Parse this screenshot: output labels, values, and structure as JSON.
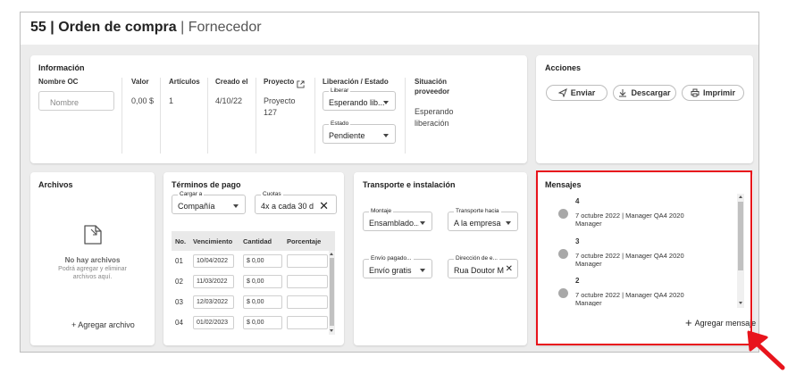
{
  "header": {
    "order_number": "55",
    "separator": "|",
    "order_label": "Orden de compra",
    "supplier": "| Fornecedor"
  },
  "info": {
    "title": "Información",
    "nombre_oc_label": "Nombre OC",
    "nombre_oc_placeholder": "Nombre",
    "valor_label": "Valor",
    "valor_value": "0,00 $",
    "articulos_label": "Artículos",
    "articulos_value": "1",
    "creado_label": "Creado el",
    "creado_value": "4/10/22",
    "proyecto_label": "Proyecto",
    "proyecto_value_1": "Proyecto",
    "proyecto_value_2": "127",
    "liberacion_label": "Liberación / Estado",
    "liberar_label": "Liberar",
    "liberar_value": "Esperando lib...",
    "estado_label": "Estado",
    "estado_value": "Pendiente",
    "situacion_label_1": "Situación",
    "situacion_label_2": "proveedor",
    "situacion_value_1": "Esperando",
    "situacion_value_2": "liberación"
  },
  "acciones": {
    "title": "Acciones",
    "enviar": "Enviar",
    "descargar": "Descargar",
    "imprimir": "Imprimir"
  },
  "archivos": {
    "title": "Archivos",
    "empty_title": "No hay archivos",
    "empty_sub_1": "Podrá agregar y eliminar",
    "empty_sub_2": "archivos aquí.",
    "add": "+ Agregar archivo"
  },
  "terminos": {
    "title": "Términos de pago",
    "cargar_label": "Cargar a",
    "cargar_value": "Compañía",
    "cuotas_label": "Cuotas",
    "cuotas_value": "4x a cada 30 d",
    "columns": [
      "No.",
      "Vencimiento",
      "Cantidad",
      "Porcentaje"
    ],
    "rows": [
      {
        "no": "01",
        "fecha": "10/04/2022",
        "cantidad": "$ 0,00"
      },
      {
        "no": "02",
        "fecha": "11/03/2022",
        "cantidad": "$ 0,00"
      },
      {
        "no": "03",
        "fecha": "12/03/2022",
        "cantidad": "$ 0,00"
      },
      {
        "no": "04",
        "fecha": "01/02/2023",
        "cantidad": "$ 0,00"
      }
    ]
  },
  "transporte": {
    "title": "Transporte e instalación",
    "montaje_label": "Montaje",
    "montaje_value": "Ensamblado...",
    "hacia_label": "Transporte hacia",
    "hacia_value": "A la empresa",
    "envio_label": "Envío pagado...",
    "envio_value": "Envío gratis",
    "direccion_label": "Dirección de e...",
    "direccion_value": "Rua Doutor Mi"
  },
  "mensajes": {
    "title": "Mensajes",
    "items": [
      {
        "num": "4",
        "line1": "7 octubre 2022 | Manager QA4 2020",
        "line2": "Manager"
      },
      {
        "num": "3",
        "line1": "7 octubre 2022 | Manager QA4 2020",
        "line2": "Manager"
      },
      {
        "num": "2",
        "line1": "7 octubre 2022 | Manager QA4 2020",
        "line2": "Manager"
      }
    ],
    "add": "Agregar mensaje"
  },
  "colors": {
    "highlight": "#e8141c",
    "background": "#ececec",
    "card": "#ffffff"
  }
}
